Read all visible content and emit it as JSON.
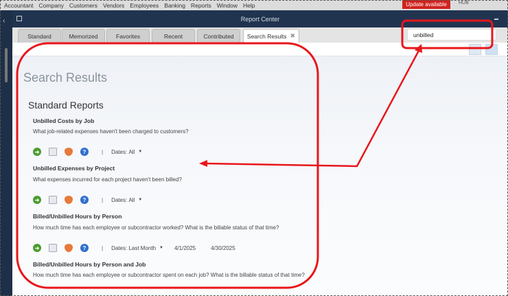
{
  "menu": [
    "Accountant",
    "Company",
    "Customers",
    "Vendors",
    "Employees",
    "Banking",
    "Reports",
    "Window",
    "Help"
  ],
  "update_label": "Update available",
  "hub_label": "HUB",
  "window_title": "Report Center",
  "tabs": [
    "Standard",
    "Memorized",
    "Favorites",
    "Recent",
    "Contributed",
    "Search Results"
  ],
  "search_value": "unbilled",
  "heading": "Search Results",
  "section": "Standard Reports",
  "dates_label": "Dates:",
  "reports": [
    {
      "title": "Unbilled Costs by Job",
      "desc": "What job-related expenses haven't been charged to customers?",
      "dates": "All"
    },
    {
      "title": "Unbilled Expenses by Project",
      "desc": "What expenses incurred for each project haven't been billed?",
      "dates": "All"
    },
    {
      "title": "Billed/Unbilled Hours by Person",
      "desc": "How much time has each employee or subcontractor worked?  What is the billable status of that time?",
      "dates": "Last Month",
      "from": "4/1/2025",
      "to": "4/30/2025"
    },
    {
      "title": "Billed/Unbilled Hours by Person and Job",
      "desc": "How much time has each employee or subcontractor spent on each job?  What is the billable status of that time?"
    }
  ],
  "colors": {
    "annotation": "#e8161b",
    "titlebar": "#203450"
  }
}
